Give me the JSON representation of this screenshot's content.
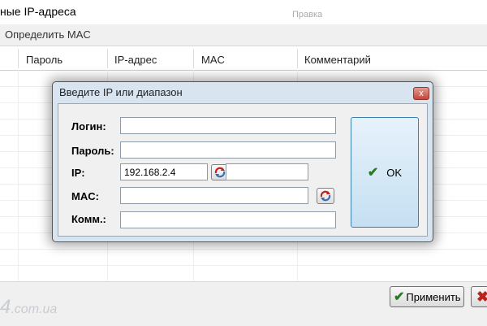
{
  "window": {
    "title": "ные IP-адреса",
    "ghost_text": "Правка"
  },
  "menu": {
    "determine_mac": "Определить MAC"
  },
  "table": {
    "columns": [
      "Пароль",
      "IP-адрес",
      "MAC",
      "Комментарий"
    ]
  },
  "dialog": {
    "title": "Введите IP или диапазон",
    "close_label": "x",
    "login_label": "Логин:",
    "login_value": "",
    "password_label": "Пароль:",
    "password_value": "",
    "ip_label": "IP:",
    "ip_value": "192.168.2.4",
    "mac_label": "MAC:",
    "mac_value": "",
    "comment_label": "Комм.:",
    "comment_value": "",
    "ok_label": "OK"
  },
  "footer": {
    "apply_label": "Применить",
    "watermark_text": "4",
    "watermark_small": ".com.ua"
  },
  "colors": {
    "dialog_bg": "#d9e4f1",
    "ok_bg": "#c5dff2",
    "close_red": "#c5473a"
  }
}
